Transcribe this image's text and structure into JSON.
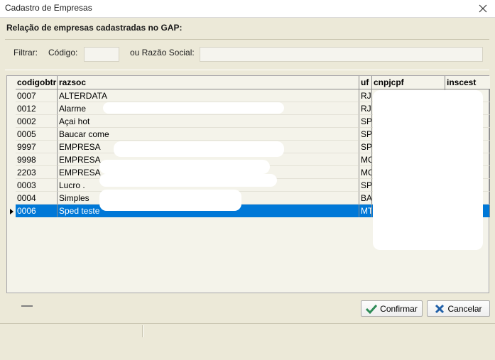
{
  "window": {
    "title": "Cadastro de Empresas",
    "close_icon": "close-icon"
  },
  "heading": "Relação de empresas cadastradas no GAP:",
  "filter": {
    "label": "Filtrar:",
    "codigo_label": "Código:",
    "codigo_value": "",
    "razao_label": "ou Razão Social:",
    "razao_value": ""
  },
  "grid": {
    "columns": [
      "codigobtr",
      "razsoc",
      "uf",
      "cnpjcpf",
      "inscest"
    ],
    "rows": [
      {
        "codigo": "0007",
        "razsoc": "ALTERDATA",
        "uf": "RJ",
        "cnpjcpf": "",
        "inscest": ""
      },
      {
        "codigo": "0012",
        "razsoc": "Alarme",
        "uf": "RJ",
        "cnpjcpf": "",
        "inscest": ""
      },
      {
        "codigo": "0002",
        "razsoc": "Açai hot",
        "uf": "SP",
        "cnpjcpf": "",
        "inscest": ""
      },
      {
        "codigo": "0005",
        "razsoc": "Baucar come",
        "uf": "SP",
        "cnpjcpf": "",
        "inscest": ""
      },
      {
        "codigo": "9997",
        "razsoc": "EMPRESA",
        "uf": "SP",
        "cnpjcpf": "",
        "inscest": ""
      },
      {
        "codigo": "9998",
        "razsoc": "EMPRESA",
        "uf": "MG",
        "cnpjcpf": "",
        "inscest": ""
      },
      {
        "codigo": "2203",
        "razsoc": "EMPRESA",
        "uf": "MG",
        "cnpjcpf": "",
        "inscest": ""
      },
      {
        "codigo": "0003",
        "razsoc": "Lucro .",
        "uf": "SP",
        "cnpjcpf": "",
        "inscest": ""
      },
      {
        "codigo": "0004",
        "razsoc": "Simples",
        "uf": "BA",
        "cnpjcpf": "",
        "inscest": ""
      },
      {
        "codigo": "0006",
        "razsoc": "Sped teste",
        "uf": "MT",
        "cnpjcpf": "",
        "inscest": ""
      }
    ],
    "selected_index": 9
  },
  "buttons": {
    "confirmar": "Confirmar",
    "cancelar": "Cancelar"
  },
  "colors": {
    "selection": "#0078d7",
    "confirm_icon": "#2e8b57",
    "cancel_icon": "#1f5fa8"
  }
}
